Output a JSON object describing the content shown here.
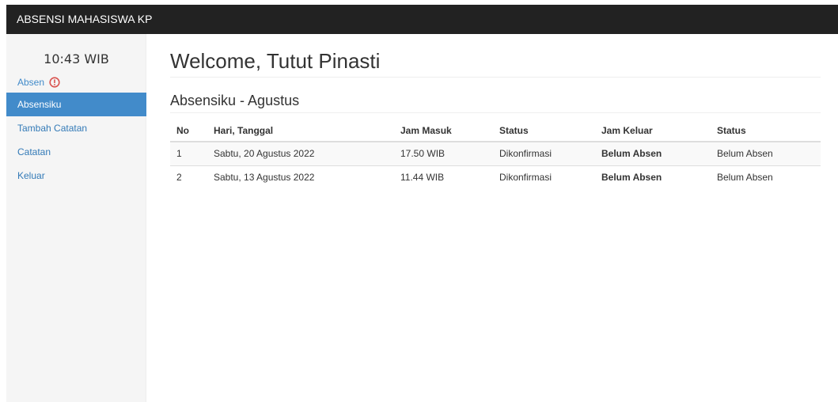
{
  "navbar": {
    "brand": "ABSENSI MAHASISWA KP"
  },
  "sidebar": {
    "clock": "10:43 WIB",
    "absen_label": "Absen",
    "items": [
      {
        "label": "Absensiku",
        "active": true
      },
      {
        "label": "Tambah Catatan",
        "active": false
      },
      {
        "label": "Catatan",
        "active": false
      },
      {
        "label": "Keluar",
        "active": false
      }
    ]
  },
  "main": {
    "title": "Welcome, Tutut Pinasti",
    "subtitle": "Absensiku - Agustus",
    "table": {
      "headers": [
        "No",
        "Hari, Tanggal",
        "Jam Masuk",
        "Status",
        "Jam Keluar",
        "Status"
      ],
      "rows": [
        [
          "1",
          "Sabtu, 20 Agustus 2022",
          "17.50 WIB",
          "Dikonfirmasi",
          "Belum Absen",
          "Belum Absen"
        ],
        [
          "2",
          "Sabtu, 13 Agustus 2022",
          "11.44 WIB",
          "Dikonfirmasi",
          "Belum Absen",
          "Belum Absen"
        ]
      ]
    }
  },
  "colors": {
    "navbar_bg": "#222222",
    "sidebar_bg": "#f5f5f5",
    "active_item_bg": "#428bca",
    "link": "#337ab7",
    "alert": "#d9534f"
  },
  "icons": {
    "absen_alert": "exclamation-circle-icon"
  }
}
